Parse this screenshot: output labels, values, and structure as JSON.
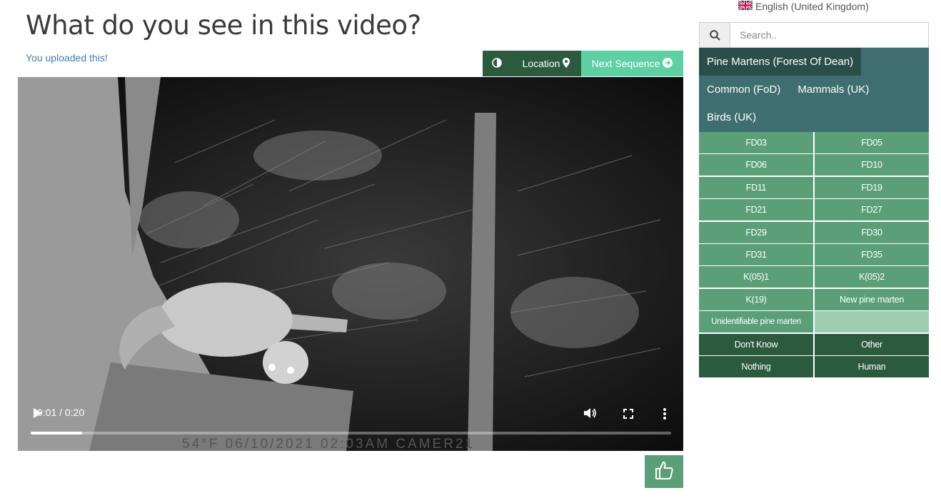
{
  "page": {
    "title": "What do you see in this video?",
    "uploaded_note": "You uploaded this!"
  },
  "language": {
    "label": "English (United Kingdom)",
    "flag_icon": "uk-flag-icon"
  },
  "toolbar": {
    "contrast_icon": "contrast-icon",
    "location_label": "Location",
    "location_icon": "map-marker-icon",
    "next_label": "Next Sequence",
    "next_icon": "arrow-circle-right-icon"
  },
  "video": {
    "time": "0:01 / 0:20",
    "progress": 0.08,
    "overlay_text": "54°F   06/10/2021   02:03AM   CAMER21",
    "controls": [
      "play-icon",
      "volume-icon",
      "fullscreen-icon",
      "more-vert-icon"
    ]
  },
  "like": {
    "icon": "thumbs-up-icon"
  },
  "search": {
    "placeholder": "Search.."
  },
  "categories": {
    "row1": [
      "Pine Martens (Forest Of Dean)"
    ],
    "row2": [
      "Common (FoD)",
      "Mammals (UK)"
    ],
    "row3": [
      "Birds (UK)"
    ],
    "active": "Pine Martens (Forest Of Dean)"
  },
  "species": [
    "FD03",
    "FD05",
    "FD06",
    "FD10",
    "FD11",
    "FD19",
    "FD21",
    "FD27",
    "FD29",
    "FD30",
    "FD31",
    "FD35",
    "K(05)1",
    "K(05)2",
    "K(19)",
    "New pine marten",
    "Unidentifiable pine marten",
    ""
  ],
  "special_options": [
    "Don't Know",
    "Other",
    "Nothing",
    "Human"
  ],
  "colors": {
    "dark_green": "#2c5a3f",
    "teal_header": "#3e6e70",
    "active_category": "#2a4f4b",
    "cell_green": "#5a9f78",
    "next_button": "#5fcfa4",
    "link_blue": "#3f7fa8"
  }
}
